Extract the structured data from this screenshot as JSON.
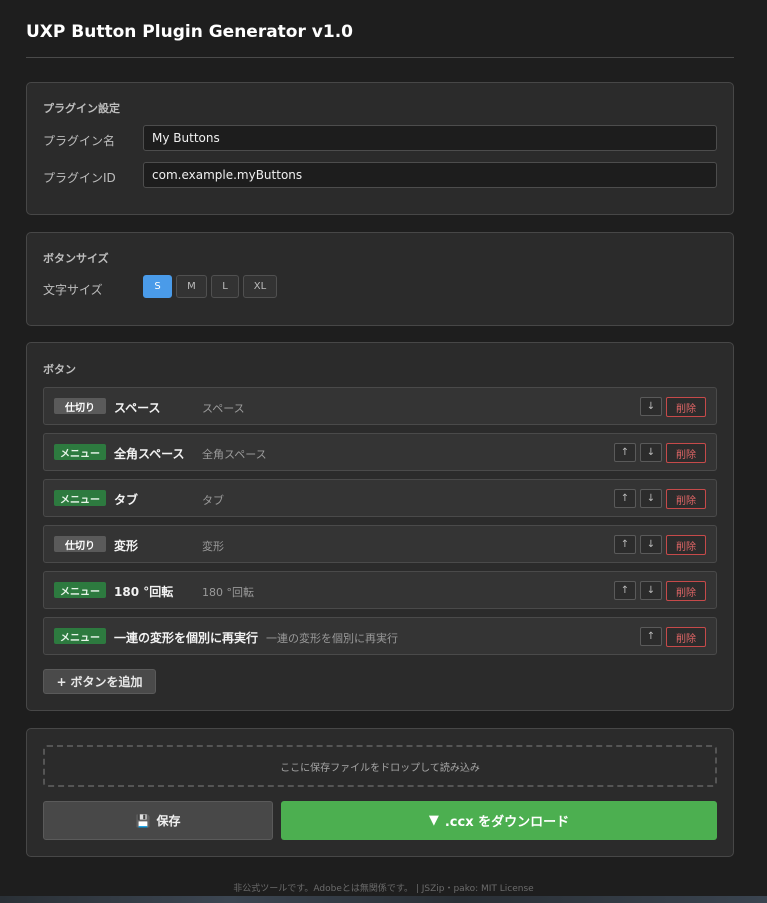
{
  "app": {
    "title": "UXP Button Plugin Generator v1.0"
  },
  "plugin_settings": {
    "title": "プラグイン設定",
    "name_label": "プラグイン名",
    "name_value": "My Buttons",
    "id_label": "プラグインID",
    "id_value": "com.example.myButtons"
  },
  "button_size": {
    "title": "ボタンサイズ",
    "font_size_label": "文字サイズ",
    "options": [
      "S",
      "M",
      "L",
      "XL"
    ],
    "selected": "S"
  },
  "buttons": {
    "title": "ボタン",
    "rows": [
      {
        "badge": "仕切り",
        "type": "separator",
        "name": "スペース",
        "desc": "スペース",
        "up": false,
        "down": true
      },
      {
        "badge": "メニュー",
        "type": "menu",
        "name": "全角スペース",
        "desc": "全角スペース",
        "up": true,
        "down": true
      },
      {
        "badge": "メニュー",
        "type": "menu",
        "name": "タブ",
        "desc": "タブ",
        "up": true,
        "down": true
      },
      {
        "badge": "仕切り",
        "type": "separator",
        "name": "変形",
        "desc": "変形",
        "up": true,
        "down": true
      },
      {
        "badge": "メニュー",
        "type": "menu",
        "name": "180 °回転",
        "desc": "180 °回転",
        "up": true,
        "down": true
      },
      {
        "badge": "メニュー",
        "type": "menu",
        "name": "一連の変形を個別に再実行",
        "desc": "一連の変形を個別に再実行",
        "up": true,
        "down": false
      }
    ],
    "up_glyph": "↑",
    "down_glyph": "↓",
    "delete_label": "削除",
    "add_icon": "+",
    "add_label": "ボタンを追加"
  },
  "export": {
    "drop_text": "ここに保存ファイルをドロップして読み込み",
    "save_icon": "💾",
    "save_label": "保存",
    "download_icon": "▼",
    "download_label": ".ccx をダウンロード"
  },
  "footer": {
    "text": "非公式ツールです。Adobeとは無関係です。 | JSZip・pako: MIT License"
  },
  "colors": {
    "accent_blue": "#4a9be9",
    "download_green": "#4caf50",
    "menu_badge": "#2d7a3f",
    "delete_red": "#e06666"
  }
}
